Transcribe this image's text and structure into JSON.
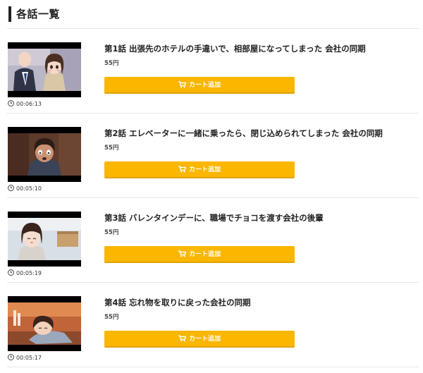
{
  "section_title": "各話一覧",
  "episodes": [
    {
      "title": "第1話 出張先のホテルの手違いで、相部屋になってしまった 会社の同期",
      "price": "55円",
      "duration": "00:06:13",
      "cart_label": "カート追加",
      "thumbnail_icon": "episode-1-thumbnail"
    },
    {
      "title": "第2話 エレベーターに一緒に乗ったら、閉じ込められてしまった 会社の同期",
      "price": "55円",
      "duration": "00:05:10",
      "cart_label": "カート追加",
      "thumbnail_icon": "episode-2-thumbnail"
    },
    {
      "title": "第3話 バレンタインデーに、職場でチョコを渡す会社の後輩",
      "price": "55円",
      "duration": "00:05:19",
      "cart_label": "カート追加",
      "thumbnail_icon": "episode-3-thumbnail"
    },
    {
      "title": "第4話 忘れ物を取りに戻った会社の同期",
      "price": "55円",
      "duration": "00:05:17",
      "cart_label": "カート追加",
      "thumbnail_icon": "episode-4-thumbnail"
    }
  ],
  "colors": {
    "button": "#fbb600",
    "button_shadow": "#e0a200",
    "button_text": "#ffffff",
    "title_bar": "#222222"
  }
}
